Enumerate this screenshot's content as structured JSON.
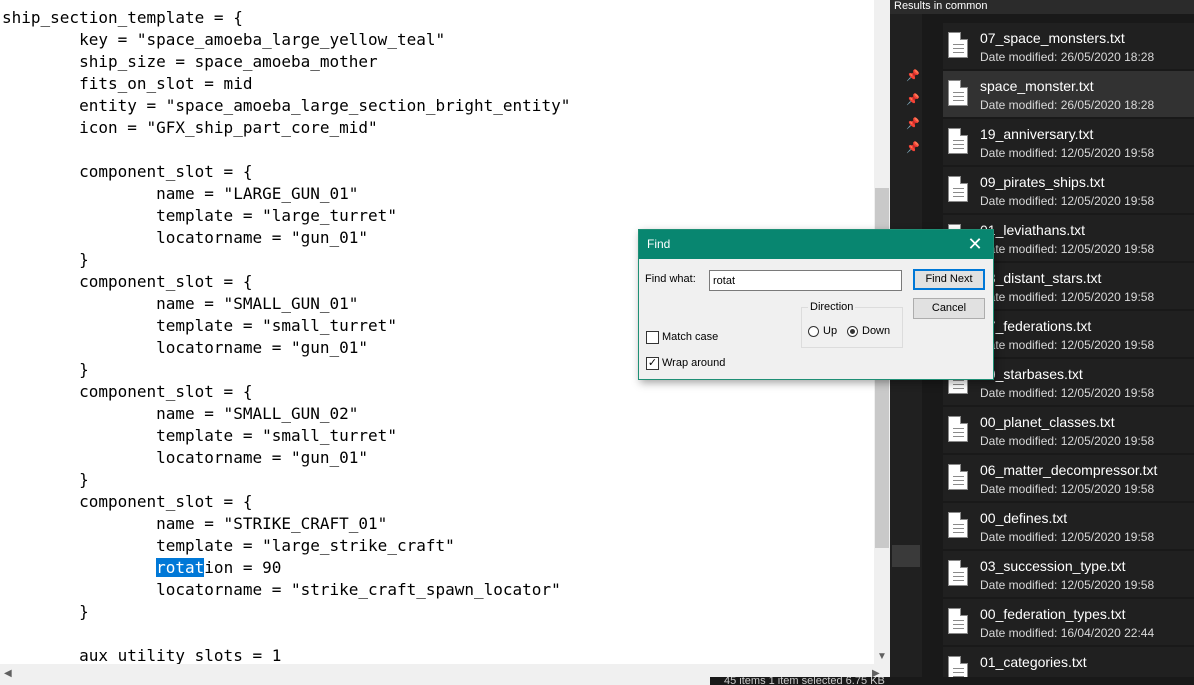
{
  "editor": {
    "lines": [
      "ship_section_template = {",
      "\tkey = \"space_amoeba_large_yellow_teal\"",
      "\tship_size = space_amoeba_mother",
      "\tfits_on_slot = mid",
      "\tentity = \"space_amoeba_large_section_bright_entity\"",
      "\ticon = \"GFX_ship_part_core_mid\"",
      "",
      "\tcomponent_slot = {",
      "\t\tname = \"LARGE_GUN_01\"",
      "\t\ttemplate = \"large_turret\"",
      "\t\tlocatorname = \"gun_01\"",
      "\t}",
      "\tcomponent_slot = {",
      "\t\tname = \"SMALL_GUN_01\"",
      "\t\ttemplate = \"small_turret\"",
      "\t\tlocatorname = \"gun_01\"",
      "\t}",
      "\tcomponent_slot = {",
      "\t\tname = \"SMALL_GUN_02\"",
      "\t\ttemplate = \"small_turret\"",
      "\t\tlocatorname = \"gun_01\"",
      "\t}",
      "\tcomponent_slot = {",
      "\t\tname = \"STRIKE_CRAFT_01\"",
      "\t\ttemplate = \"large_strike_craft\"",
      "\t\trotation = 90",
      "\t\tlocatorname = \"strike_craft_spawn_locator\"",
      "\t}",
      "",
      "\taux_utility_slots = 1"
    ],
    "highlight": {
      "line": 25,
      "text": "rotat"
    }
  },
  "results_panel": {
    "title": "Results in common",
    "files": [
      {
        "name": "07_space_monsters.txt",
        "date": "Date modified: 26/05/2020 18:28",
        "selected": false
      },
      {
        "name": "space_monster.txt",
        "date": "Date modified: 26/05/2020 18:28",
        "selected": true
      },
      {
        "name": "19_anniversary.txt",
        "date": "Date modified: 12/05/2020 19:58",
        "selected": false
      },
      {
        "name": "09_pirates_ships.txt",
        "date": "Date modified: 12/05/2020 19:58",
        "selected": false
      },
      {
        "name": "01_leviathans.txt",
        "date": "Date modified: 12/05/2020 19:58",
        "selected": false
      },
      {
        "name": "03_distant_stars.txt",
        "date": "Date modified: 12/05/2020 19:58",
        "selected": false
      },
      {
        "name": "07_federations.txt",
        "date": "Date modified: 12/05/2020 19:58",
        "selected": false
      },
      {
        "name": "00_starbases.txt",
        "date": "Date modified: 12/05/2020 19:58",
        "selected": false
      },
      {
        "name": "00_planet_classes.txt",
        "date": "Date modified: 12/05/2020 19:58",
        "selected": false
      },
      {
        "name": "06_matter_decompressor.txt",
        "date": "Date modified: 12/05/2020 19:58",
        "selected": false
      },
      {
        "name": "00_defines.txt",
        "date": "Date modified: 12/05/2020 19:58",
        "selected": false
      },
      {
        "name": "03_succession_type.txt",
        "date": "Date modified: 12/05/2020 19:58",
        "selected": false
      },
      {
        "name": "00_federation_types.txt",
        "date": "Date modified: 16/04/2020 22:44",
        "selected": false
      },
      {
        "name": "01_categories.txt",
        "date": "",
        "selected": false
      }
    ],
    "status": "45 items    1 item selected  6.75 KB"
  },
  "find_dialog": {
    "title": "Find",
    "find_what_label": "Find what:",
    "find_what_value": "rotat",
    "find_next_label": "Find Next",
    "cancel_label": "Cancel",
    "direction_label": "Direction",
    "up_label": "Up",
    "down_label": "Down",
    "direction_selected": "Down",
    "match_case_label": "Match case",
    "match_case_checked": false,
    "wrap_around_label": "Wrap around",
    "wrap_around_checked": true
  },
  "icons": {
    "close": "close-icon",
    "pin": "pin-icon",
    "file": "text-file-icon"
  }
}
